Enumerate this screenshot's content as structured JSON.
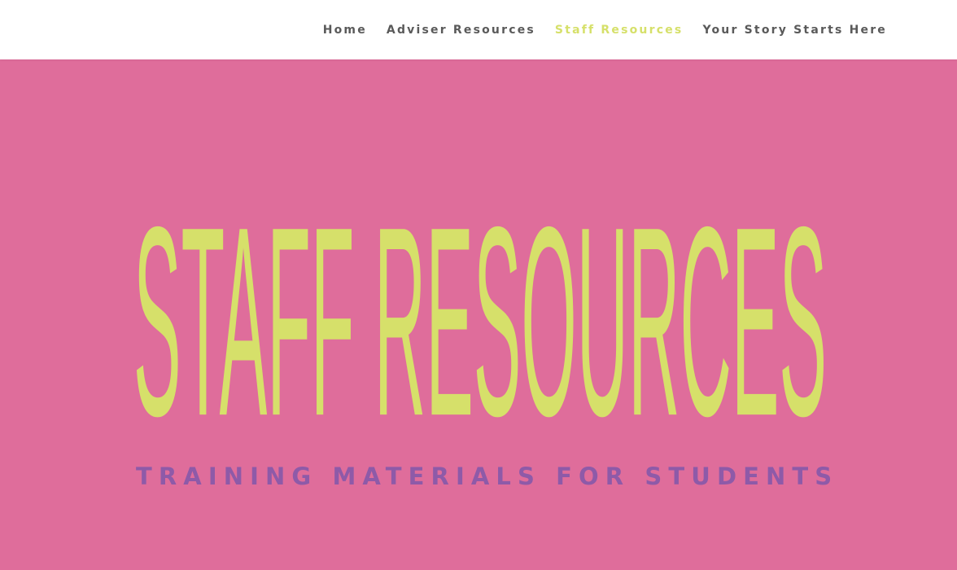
{
  "nav": {
    "items": [
      {
        "label": "Home"
      },
      {
        "label": "Adviser Resources"
      },
      {
        "label": "Staff Resources",
        "active": true
      },
      {
        "label": "Your Story Starts Here"
      }
    ]
  },
  "hero": {
    "title": "STAFF RESOURCES",
    "subtitle": "TRAINING MATERIALS FOR STUDENTS"
  },
  "colors": {
    "hero_background": "#df6d9b",
    "title_color": "#d6e06a",
    "subtitle_color": "#8e5aa8",
    "nav_text": "#5a5a5a",
    "nav_active": "#d6e06a"
  }
}
